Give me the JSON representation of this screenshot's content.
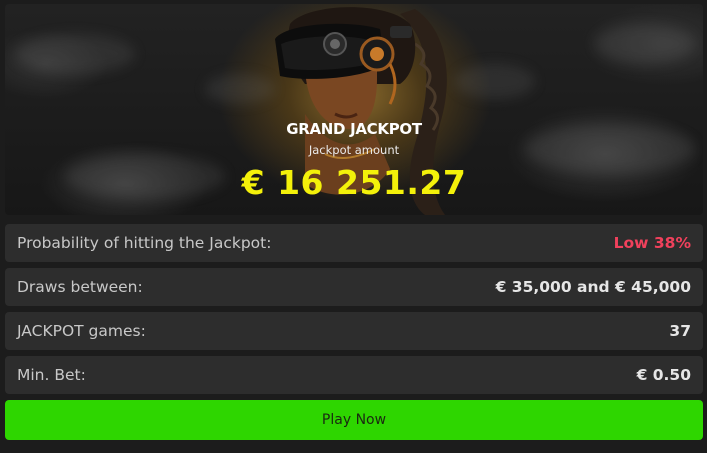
{
  "banner": {
    "title": "GRAND JACKPOT",
    "amount_label": "Jackpot amount",
    "amount": "€ 16 251.27"
  },
  "rows": [
    {
      "label": "Probability of hitting the Jackpot:",
      "value": "Low 38%",
      "value_color": "#f0415c"
    },
    {
      "label": "Draws between:",
      "value": "€ 35,000 and € 45,000"
    },
    {
      "label": "JACKPOT games:",
      "value": "37"
    },
    {
      "label": "Min. Bet:",
      "value": "€ 0.50"
    }
  ],
  "play_button": {
    "label": "Play Now",
    "color": "#2ed600"
  },
  "colors": {
    "amount": "#f4f10a",
    "background": "#1c1c1c",
    "row_bg": "#2d2d2d"
  }
}
